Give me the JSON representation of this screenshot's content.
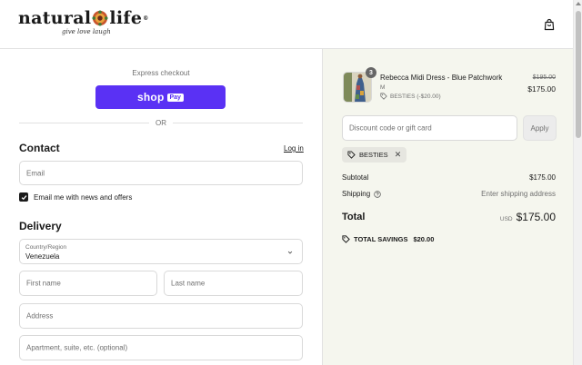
{
  "brand": {
    "name_part1": "natural",
    "name_part2": "life",
    "registered": "®",
    "tagline": "give love laugh"
  },
  "express": {
    "label": "Express checkout",
    "shop_word": "shop",
    "pay_word": "Pay",
    "or_text": "OR"
  },
  "contact": {
    "heading": "Contact",
    "login_link": "Log in",
    "email_placeholder": "Email",
    "newsletter_label": "Email me with news and offers",
    "newsletter_checked": true
  },
  "delivery": {
    "heading": "Delivery",
    "country_label": "Country/Region",
    "country_value": "Venezuela",
    "first_name_placeholder": "First name",
    "last_name_placeholder": "Last name",
    "address_placeholder": "Address",
    "apartment_placeholder": "Apartment, suite, etc. (optional)"
  },
  "summary": {
    "product": {
      "quantity": "3",
      "name": "Rebecca Midi Dress - Blue Patchwork",
      "variant": "M",
      "discount": "BESTIES (-$20.00)",
      "price_original": "$195.00",
      "price_current": "$175.00"
    },
    "discount_placeholder": "Discount code or gift card",
    "apply_label": "Apply",
    "applied_code": "BESTIES",
    "subtotal_label": "Subtotal",
    "subtotal_value": "$175.00",
    "shipping_label": "Shipping",
    "shipping_value": "Enter shipping address",
    "total_label": "Total",
    "total_currency": "USD",
    "total_value": "$175.00",
    "savings_label": "TOTAL SAVINGS",
    "savings_value": "$20.00"
  },
  "colors": {
    "shop_pay": "#5a31f4",
    "summary_bg": "#f5f6ee",
    "text": "#1a1a1a",
    "muted": "#707070"
  }
}
